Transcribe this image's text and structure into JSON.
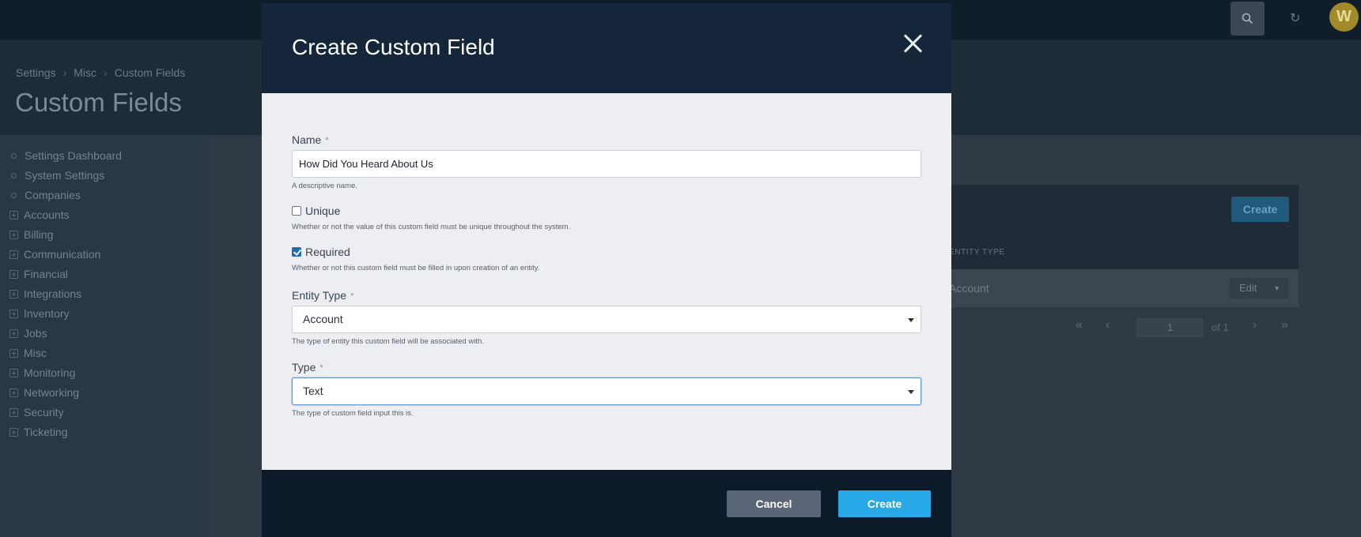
{
  "topbar": {
    "avatar_initial": "W",
    "refresh_glyph": "↻"
  },
  "breadcrumb": [
    "Settings",
    "Misc",
    "Custom Fields"
  ],
  "page": {
    "title": "Custom Fields"
  },
  "sidebar": {
    "items": [
      {
        "label": "Settings Dashboard",
        "icon": "dot"
      },
      {
        "label": "System Settings",
        "icon": "dot"
      },
      {
        "label": "Companies",
        "icon": "dot"
      },
      {
        "label": "Accounts",
        "icon": "plus"
      },
      {
        "label": "Billing",
        "icon": "plus"
      },
      {
        "label": "Communication",
        "icon": "plus"
      },
      {
        "label": "Financial",
        "icon": "plus"
      },
      {
        "label": "Integrations",
        "icon": "plus"
      },
      {
        "label": "Inventory",
        "icon": "plus"
      },
      {
        "label": "Jobs",
        "icon": "plus"
      },
      {
        "label": "Misc",
        "icon": "plus"
      },
      {
        "label": "Monitoring",
        "icon": "plus"
      },
      {
        "label": "Networking",
        "icon": "plus"
      },
      {
        "label": "Security",
        "icon": "plus"
      },
      {
        "label": "Ticketing",
        "icon": "plus"
      }
    ]
  },
  "table": {
    "create_label": "Create",
    "column_entity_type": "ENTITY TYPE",
    "row": {
      "entity_type": "Account",
      "action_label": "Edit"
    },
    "pagination": {
      "current_page": "1",
      "of_label": "of 1"
    }
  },
  "modal": {
    "title": "Create Custom Field",
    "fields": {
      "name": {
        "label": "Name",
        "required_mark": "*",
        "value": "How Did You Heard About Us",
        "help": "A descriptive name."
      },
      "unique": {
        "label": "Unique",
        "checked": false,
        "help": "Whether or not the value of this custom field must be unique throughout the system."
      },
      "required": {
        "label": "Required",
        "checked": true,
        "help": "Whether or not this custom field must be filled in upon creation of an entity."
      },
      "entity_type": {
        "label": "Entity Type",
        "required_mark": "*",
        "value": "Account",
        "help": "The type of entity this custom field will be associated with."
      },
      "type": {
        "label": "Type",
        "required_mark": "*",
        "value": "Text",
        "help": "The type of custom field input this is."
      }
    },
    "buttons": {
      "cancel": "Cancel",
      "create": "Create"
    }
  },
  "colors": {
    "modal_header": "#15263a",
    "modal_footer": "#0c1a2a",
    "primary": "#29a8e8",
    "secondary": "#5a6678"
  }
}
